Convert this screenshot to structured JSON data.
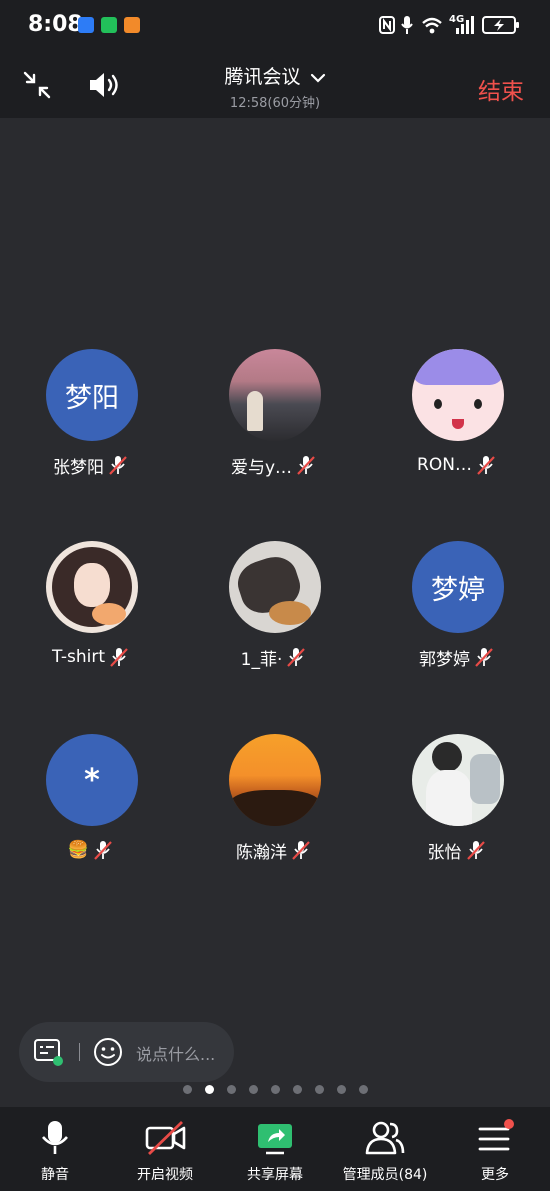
{
  "status": {
    "time": "8:08",
    "network": "4G"
  },
  "meeting": {
    "title": "腾讯会议",
    "duration": "12:58(60分钟)",
    "end_label": "结束"
  },
  "participants": [
    {
      "name": "张梦阳",
      "avatar_text": "梦阳",
      "avatar_type": "text"
    },
    {
      "name": "爱与y…",
      "avatar_type": "photo"
    },
    {
      "name": "RON…",
      "avatar_type": "illustration"
    },
    {
      "name": "T-shirt",
      "avatar_type": "illustration"
    },
    {
      "name": "1_菲·",
      "avatar_type": "photo"
    },
    {
      "name": "郭梦婷",
      "avatar_text": "梦婷",
      "avatar_type": "text"
    },
    {
      "name": "🍔",
      "avatar_text": "*",
      "avatar_type": "text"
    },
    {
      "name": "陈瀚洋",
      "avatar_type": "photo"
    },
    {
      "name": "张怡",
      "avatar_type": "photo"
    }
  ],
  "chat": {
    "placeholder": "说点什么..."
  },
  "pagination": {
    "pages": 9,
    "current": 2
  },
  "toolbar": {
    "mute": "静音",
    "video": "开启视频",
    "share": "共享屏幕",
    "members": "管理成员(84)",
    "more": "更多"
  },
  "colors": {
    "accent_red": "#f0514c",
    "avatar_blue": "#3a63b7",
    "share_green": "#2fbf71",
    "background": "#2a2b2f"
  }
}
